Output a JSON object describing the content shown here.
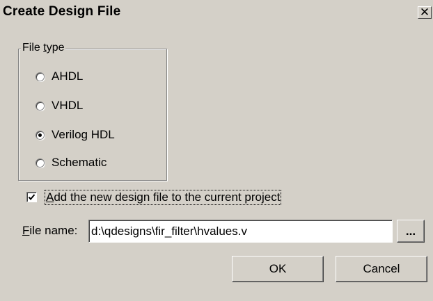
{
  "window": {
    "title": "Create Design File",
    "close_glyph": "✕"
  },
  "file_type": {
    "legend_prefix": "File ",
    "legend_accel": "t",
    "legend_suffix": "ype",
    "options": [
      {
        "label": "AHDL",
        "selected": false
      },
      {
        "label": "VHDL",
        "selected": false
      },
      {
        "label": "Verilog HDL",
        "selected": true
      },
      {
        "label": "Schematic",
        "selected": false
      }
    ]
  },
  "add_to_project": {
    "label_accel": "A",
    "label_rest": "dd the new design file to the current project",
    "checked": true
  },
  "file_name": {
    "label_accel": "F",
    "label_rest": "ile name:",
    "value": "d:\\qdesigns\\fir_filter\\hvalues.v",
    "browse_label": "..."
  },
  "buttons": {
    "ok_label": "OK",
    "cancel_label": "Cancel"
  }
}
